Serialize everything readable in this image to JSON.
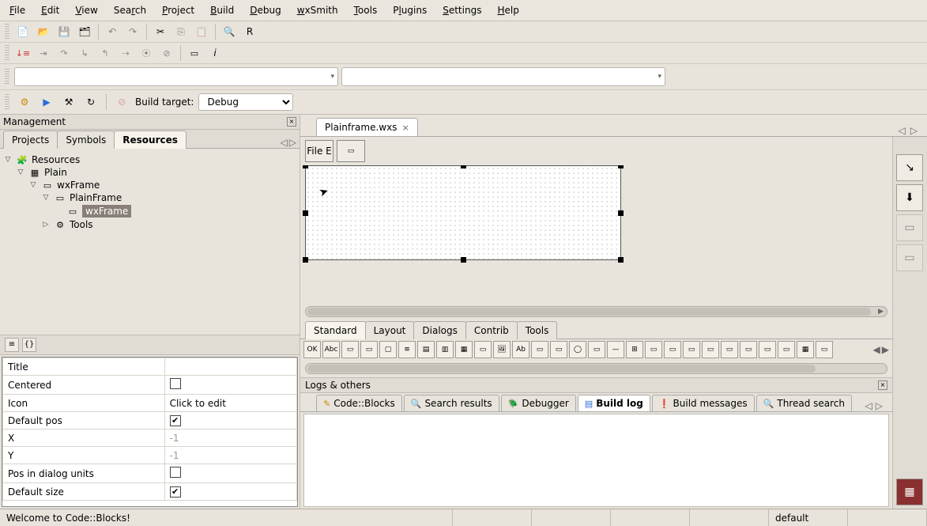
{
  "menu": [
    "File",
    "Edit",
    "View",
    "Search",
    "Project",
    "Build",
    "Debug",
    "wxSmith",
    "Tools",
    "Plugins",
    "Settings",
    "Help"
  ],
  "build_target_label": "Build target:",
  "build_target_value": "Debug",
  "management": {
    "title": "Management",
    "tabs": [
      "Projects",
      "Symbols",
      "Resources"
    ],
    "active_tab": 2,
    "tree": {
      "root": "Resources",
      "project": "Plain",
      "frame_type": "wxFrame",
      "frame_name": "PlainFrame",
      "inner": "wxFrame",
      "tools": "Tools"
    }
  },
  "properties": [
    {
      "name": "Title",
      "value": "",
      "type": "text"
    },
    {
      "name": "Centered",
      "value": false,
      "type": "check"
    },
    {
      "name": "Icon",
      "value": "Click to edit",
      "type": "text"
    },
    {
      "name": "Default pos",
      "value": true,
      "type": "check"
    },
    {
      "name": "X",
      "value": "-1",
      "type": "disabled"
    },
    {
      "name": "Y",
      "value": "-1",
      "type": "disabled"
    },
    {
      "name": "Pos in dialog units",
      "value": false,
      "type": "check"
    },
    {
      "name": "Default size",
      "value": true,
      "type": "check"
    }
  ],
  "editor": {
    "tab": "Plainframe.wxs",
    "form_button": "File E"
  },
  "palette_tabs": [
    "Standard",
    "Layout",
    "Dialogs",
    "Contrib",
    "Tools"
  ],
  "palette_active": 0,
  "logs": {
    "title": "Logs & others",
    "tabs": [
      "Code::Blocks",
      "Search results",
      "Debugger",
      "Build log",
      "Build messages",
      "Thread search"
    ],
    "active": 3
  },
  "status": {
    "message": "Welcome to Code::Blocks!",
    "mode": "default"
  }
}
